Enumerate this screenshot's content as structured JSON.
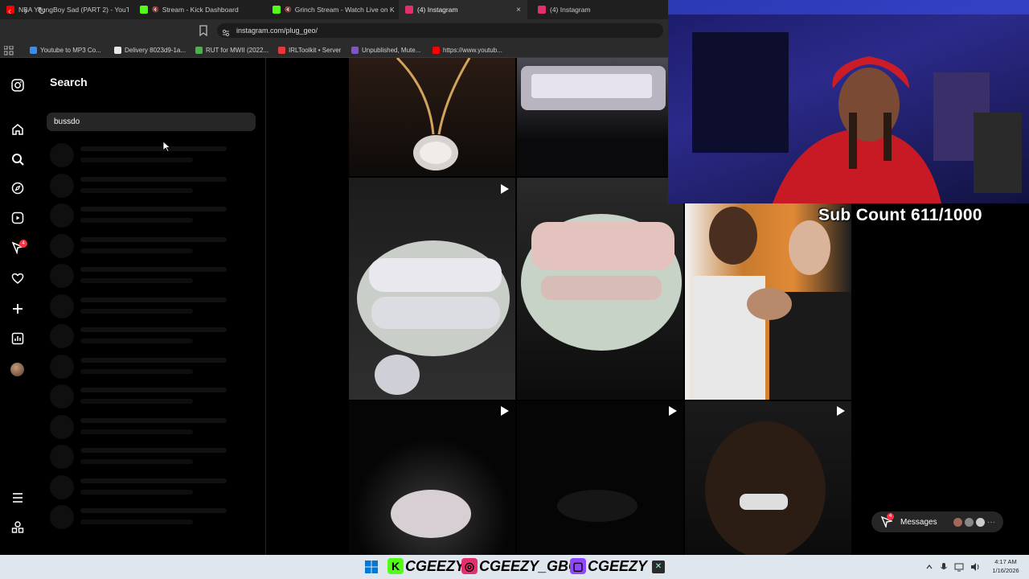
{
  "browser": {
    "tabs": [
      {
        "title": "NBA YoungBoy Sad (PART 2) - YouTu...",
        "icon": "youtube-icon",
        "color": "#ff0000"
      },
      {
        "title": "Stream - Kick Dashboard",
        "icon": "kick-icon",
        "color": "#53fc18",
        "muted": true
      },
      {
        "title": "Grinch Stream - Watch Live on Ki...",
        "icon": "kick-icon",
        "color": "#53fc18",
        "muted": true
      },
      {
        "title": "(4) Instagram",
        "icon": "instagram-icon",
        "color": "#e1306c",
        "active": true
      },
      {
        "title": "(4) Instagram",
        "icon": "instagram-icon",
        "color": "#e1306c"
      }
    ],
    "close_glyph": "×",
    "url": "instagram.com/plug_geo/",
    "bookmarks": [
      {
        "label": "Youtube to MP3 Co...",
        "color": "#3a8ee6"
      },
      {
        "label": "Delivery 8023d9-1a...",
        "color": "#e8e8e8"
      },
      {
        "label": "RUT for MWII (2022...",
        "color": "#4caf50"
      },
      {
        "label": "IRLToolkit • Server",
        "color": "#e53935"
      },
      {
        "label": "Unpublished, Mute...",
        "color": "#7e57c2"
      },
      {
        "label": "https://www.youtub...",
        "color": "#ff0000"
      }
    ]
  },
  "instagram": {
    "search": {
      "title": "Search",
      "value": "bussdo"
    },
    "notification_count": "4",
    "messages_label": "Messages",
    "messages_badge": "4"
  },
  "overlay": {
    "subcount": "Sub Count 611/1000"
  },
  "taskbar": {
    "brands": [
      {
        "text": "CGEEZY",
        "icon": "kick-icon",
        "glyph": "K",
        "color": "#53fc18"
      },
      {
        "text": "CGEEZY_GBC",
        "icon": "instagram-icon",
        "glyph": "◎",
        "color": "#e1306c"
      },
      {
        "text": "CGEEZY",
        "icon": "twitch-icon",
        "glyph": "▢",
        "color": "#9146ff"
      }
    ],
    "time": "4:17 AM",
    "date": "1/16/2026"
  }
}
